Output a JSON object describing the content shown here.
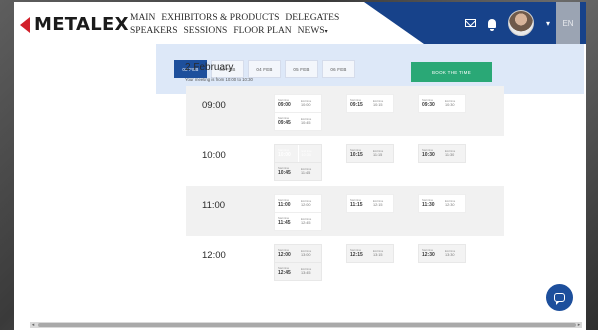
{
  "brand": {
    "name": "METALEX"
  },
  "nav": {
    "row1": [
      "MAIN",
      "EXHIBITORS & PRODUCTS",
      "DELEGATES"
    ],
    "row2": [
      "SPEAKERS",
      "SESSIONS",
      "FLOOR PLAN",
      "NEWS"
    ]
  },
  "header_right": {
    "lang": "EN"
  },
  "dates": [
    {
      "label": "02 FEB",
      "active": true
    },
    {
      "label": "03 FEB",
      "active": false
    },
    {
      "label": "04 FEB",
      "active": false
    },
    {
      "label": "05 FEB",
      "active": false
    },
    {
      "label": "06 FEB",
      "active": false
    }
  ],
  "day": {
    "title": "2 February",
    "subtitle": "Your meeting is from 10:00 to 10:30",
    "book_label": "BOOK THE TIME"
  },
  "slot_caption": {
    "start": "Start time",
    "end": "End time"
  },
  "schedule": [
    {
      "hour": "09:00",
      "slots": [
        {
          "start": "09:00",
          "end": "10:00",
          "col": 0,
          "row": 0
        },
        {
          "start": "09:45",
          "end": "10:45",
          "col": 0,
          "row": 1
        },
        {
          "start": "09:15",
          "end": "10:15",
          "col": 1,
          "row": 0
        },
        {
          "start": "09:30",
          "end": "10:30",
          "col": 2,
          "row": 0
        }
      ]
    },
    {
      "hour": "10:00",
      "slots": [
        {
          "start": "10:00",
          "end": "10:30",
          "col": 0,
          "row": 0,
          "selected": true
        },
        {
          "start": "10:45",
          "end": "11:45",
          "col": 0,
          "row": 1
        },
        {
          "start": "10:15",
          "end": "11:15",
          "col": 1,
          "row": 0
        },
        {
          "start": "10:30",
          "end": "11:30",
          "col": 2,
          "row": 0
        }
      ]
    },
    {
      "hour": "11:00",
      "slots": [
        {
          "start": "11:00",
          "end": "12:00",
          "col": 0,
          "row": 0
        },
        {
          "start": "11:45",
          "end": "12:45",
          "col": 0,
          "row": 1
        },
        {
          "start": "11:15",
          "end": "12:15",
          "col": 1,
          "row": 0
        },
        {
          "start": "11:30",
          "end": "12:30",
          "col": 2,
          "row": 0
        }
      ]
    },
    {
      "hour": "12:00",
      "slots": [
        {
          "start": "12:00",
          "end": "13:00",
          "col": 0,
          "row": 0
        },
        {
          "start": "12:45",
          "end": "13:45",
          "col": 0,
          "row": 1
        },
        {
          "start": "12:15",
          "end": "13:15",
          "col": 1,
          "row": 0
        },
        {
          "start": "12:30",
          "end": "13:30",
          "col": 2,
          "row": 0
        }
      ]
    }
  ],
  "colors": {
    "brand_blue": "#1d4f9c",
    "header_dark": "#17428a",
    "book_green": "#2aa876",
    "logo_red": "#d2202a"
  },
  "icons": {
    "mail": "mail-icon",
    "bell": "bell-icon",
    "chat": "chat-icon",
    "dropdown": "chevron-down-icon"
  }
}
